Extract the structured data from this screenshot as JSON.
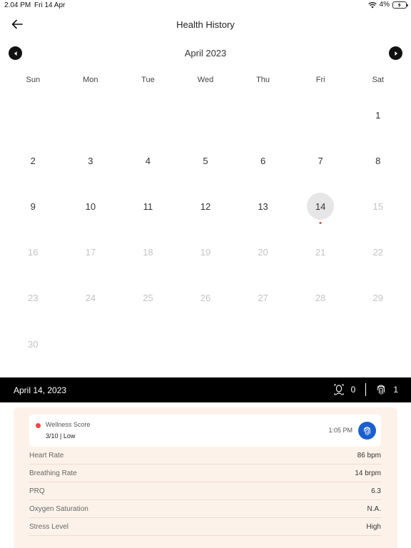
{
  "status_bar": {
    "time": "2.04 PM",
    "date": "Fri 14 Apr",
    "battery": "4%"
  },
  "nav": {
    "title": "Health History"
  },
  "calendar": {
    "month_title": "April 2023",
    "weekdays": [
      "Sun",
      "Mon",
      "Tue",
      "Wed",
      "Thu",
      "Fri",
      "Sat"
    ],
    "leading_blanks": 6,
    "days": [
      {
        "n": "1"
      },
      {
        "n": "2"
      },
      {
        "n": "3"
      },
      {
        "n": "4"
      },
      {
        "n": "5"
      },
      {
        "n": "6"
      },
      {
        "n": "7"
      },
      {
        "n": "8"
      },
      {
        "n": "9"
      },
      {
        "n": "10"
      },
      {
        "n": "11"
      },
      {
        "n": "12"
      },
      {
        "n": "13"
      },
      {
        "n": "14",
        "selected": true,
        "has_event": true
      },
      {
        "n": "15",
        "future": true
      },
      {
        "n": "16",
        "future": true
      },
      {
        "n": "17",
        "future": true
      },
      {
        "n": "18",
        "future": true
      },
      {
        "n": "19",
        "future": true
      },
      {
        "n": "20",
        "future": true
      },
      {
        "n": "21",
        "future": true
      },
      {
        "n": "22",
        "future": true
      },
      {
        "n": "23",
        "future": true
      },
      {
        "n": "24",
        "future": true
      },
      {
        "n": "25",
        "future": true
      },
      {
        "n": "26",
        "future": true
      },
      {
        "n": "27",
        "future": true
      },
      {
        "n": "28",
        "future": true
      },
      {
        "n": "29",
        "future": true
      },
      {
        "n": "30",
        "future": true
      }
    ]
  },
  "selected_day": {
    "date_label": "April 14, 2023",
    "face_scan_count": "0",
    "fingerprint_count": "1"
  },
  "wellness": {
    "title": "Wellness Score",
    "score": "3/10 | Low",
    "time": "1:05 PM"
  },
  "metrics": [
    {
      "label": "Heart Rate",
      "value": "86 bpm"
    },
    {
      "label": "Breathing Rate",
      "value": "14 brpm"
    },
    {
      "label": "PRQ",
      "value": "6.3"
    },
    {
      "label": "Oxygen Saturation",
      "value": "N.A."
    },
    {
      "label": "Stress Level",
      "value": "High"
    }
  ],
  "colors": {
    "accent_blue": "#1a5fd0",
    "event_red": "#e4443c",
    "panel_bg": "#fdf2ea",
    "date_bar_bg": "#000000"
  }
}
